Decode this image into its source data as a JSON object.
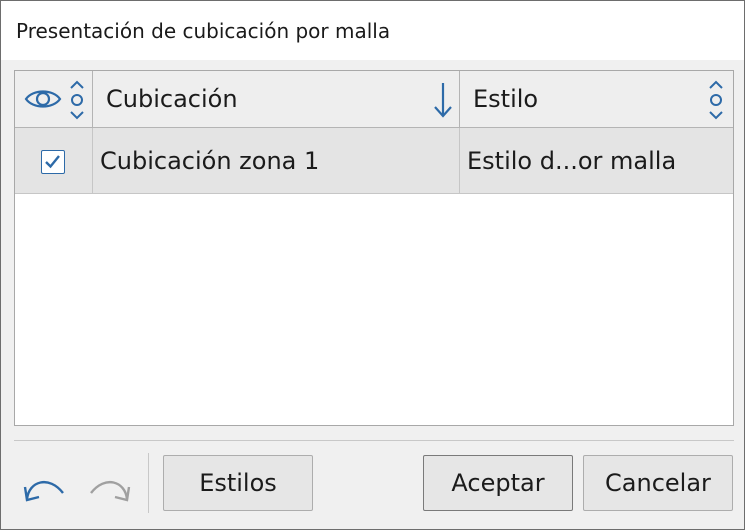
{
  "window": {
    "title": "Presentación de cubicación por malla"
  },
  "table": {
    "columns": {
      "visibility_icon": "eye-icon",
      "cubicacion": "Cubicación",
      "estilo": "Estilo"
    },
    "sort": {
      "column": "cubicacion",
      "direction": "descending"
    },
    "rows": [
      {
        "visible": true,
        "cubicacion": "Cubicación zona 1",
        "estilo": "Estilo d...or malla"
      }
    ]
  },
  "toolbar": {
    "undo_icon": "undo-icon",
    "redo_icon": "redo-icon",
    "estilos_label": "Estilos"
  },
  "buttons": {
    "aceptar_label": "Aceptar",
    "cancelar_label": "Cancelar"
  },
  "colors": {
    "accent": "#2d6aa8",
    "row_background": "#e4e4e4",
    "header_background": "#eeeeee",
    "disabled_icon": "#a0a0a0"
  }
}
